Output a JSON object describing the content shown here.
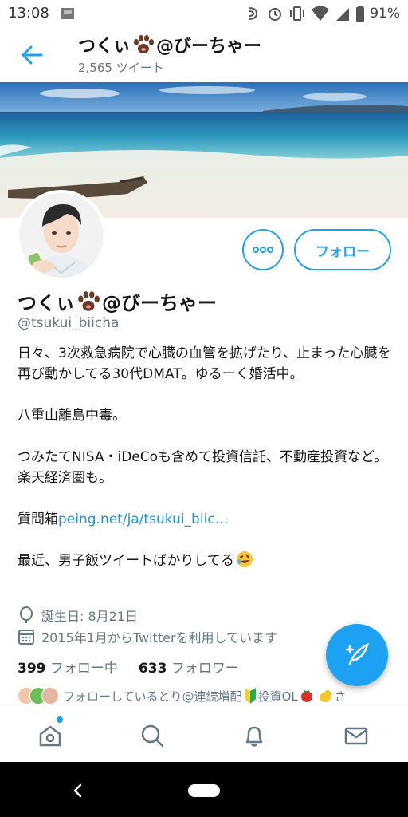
{
  "status_bar": {
    "time": "13:08",
    "battery_percent": "91%",
    "icons": [
      "nfc-icon",
      "alarm-icon",
      "vibrate-icon",
      "wifi-icon",
      "signal-icon",
      "battery-icon"
    ]
  },
  "header": {
    "title_prefix": "つくぃ",
    "title_suffix": "@びーちゃー",
    "tweet_count": "2,565 ツイート",
    "back_icon": "arrow-left-icon"
  },
  "profile": {
    "name_prefix": "つくぃ",
    "name_suffix": "@びーちゃー",
    "handle": "@tsukui_biicha",
    "follow_label": "フォロー",
    "bio": {
      "line1": "日々、3次救急病院で心臓の血管を拡げたり、止まった心臓を再び動かしてる30代DMAT。ゆるーく婚活中。",
      "line2": "八重山離島中毒。",
      "line3": "つみたてNISA・iDeCoも含めて投資信託、不動産投資など。楽天経済圏も。",
      "line4_prefix": "質問箱",
      "line4_link": "peing.net/ja/tsukui_biic…",
      "line5": "最近、男子飯ツイートばかりしてる"
    },
    "birthday": "誕生日: 8月21日",
    "joined": "2015年1月からTwitterを利用しています",
    "following_count": "399",
    "following_label": "フォロー中",
    "followers_count": "633",
    "followers_label": "フォロワー",
    "followed_by": "フォローしているとり@連続増配",
    "followed_by_tail": "投資OL",
    "followed_by_end": "さ"
  },
  "colors": {
    "accent": "#1da1f2",
    "link": "#1b95e0",
    "muted": "#657786",
    "text": "#14171a"
  },
  "bottom_nav": [
    "home-icon",
    "search-icon",
    "notifications-icon",
    "messages-icon"
  ]
}
